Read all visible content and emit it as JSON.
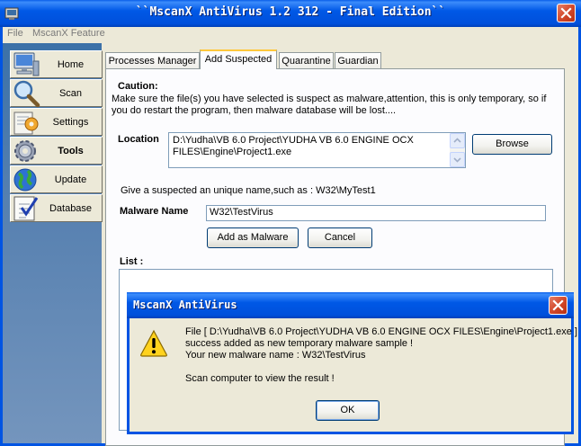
{
  "window": {
    "title": "``MscanX AntiVirus 1.2 312  - Final Edition``",
    "icons": {
      "app": "app-icon",
      "close": "close-icon"
    }
  },
  "menu": {
    "items": [
      "File",
      "MscanX Feature"
    ]
  },
  "sidebar": {
    "items": [
      {
        "label": "Home",
        "icon": "computer-icon",
        "bold": false
      },
      {
        "label": "Scan",
        "icon": "magnifier-icon",
        "bold": false
      },
      {
        "label": "Settings",
        "icon": "settings-icon",
        "bold": false
      },
      {
        "label": "Tools",
        "icon": "gears-icon",
        "bold": true
      },
      {
        "label": "Update",
        "icon": "globe-icon",
        "bold": false
      },
      {
        "label": "Database",
        "icon": "checklist-icon",
        "bold": false
      }
    ]
  },
  "tabs": [
    "Processes Manager",
    "Add Suspected",
    "Quarantine",
    "Guardian"
  ],
  "active_tab": "Add Suspected",
  "add_suspected": {
    "caution_title": "Caution:",
    "caution_text_1": "Make sure the file(s) you have selected is suspect as malware,attention, this is only temporary, so if",
    "caution_text_2": "you do restart the program, then malware database will be lost....",
    "location_label": "Location",
    "location_line_1": "D:\\Yudha\\VB 6.0 Project\\YUDHA VB 6.0 ENGINE OCX",
    "location_line_2": "FILES\\Engine\\Project1.exe",
    "browse_label": "Browse",
    "hint": "Give a suspected an unique name,such as : W32\\MyTest1",
    "malware_name_label": "Malware Name",
    "malware_name_value": "W32\\TestVirus",
    "add_button": "Add as Malware",
    "cancel_button": "Cancel",
    "list_label": "List :"
  },
  "dialog": {
    "title": "MscanX AntiVirus",
    "line_1": "File [ D:\\Yudha\\VB 6.0 Project\\YUDHA VB 6.0 ENGINE OCX FILES\\Engine\\Project1.exe ]",
    "line_2": "success added as new temporary malware sample !",
    "line_3": "Your new malware name : W32\\TestVirus",
    "line_4": "Scan computer to view the result !",
    "ok_label": "OK",
    "icon": "warning-icon"
  }
}
